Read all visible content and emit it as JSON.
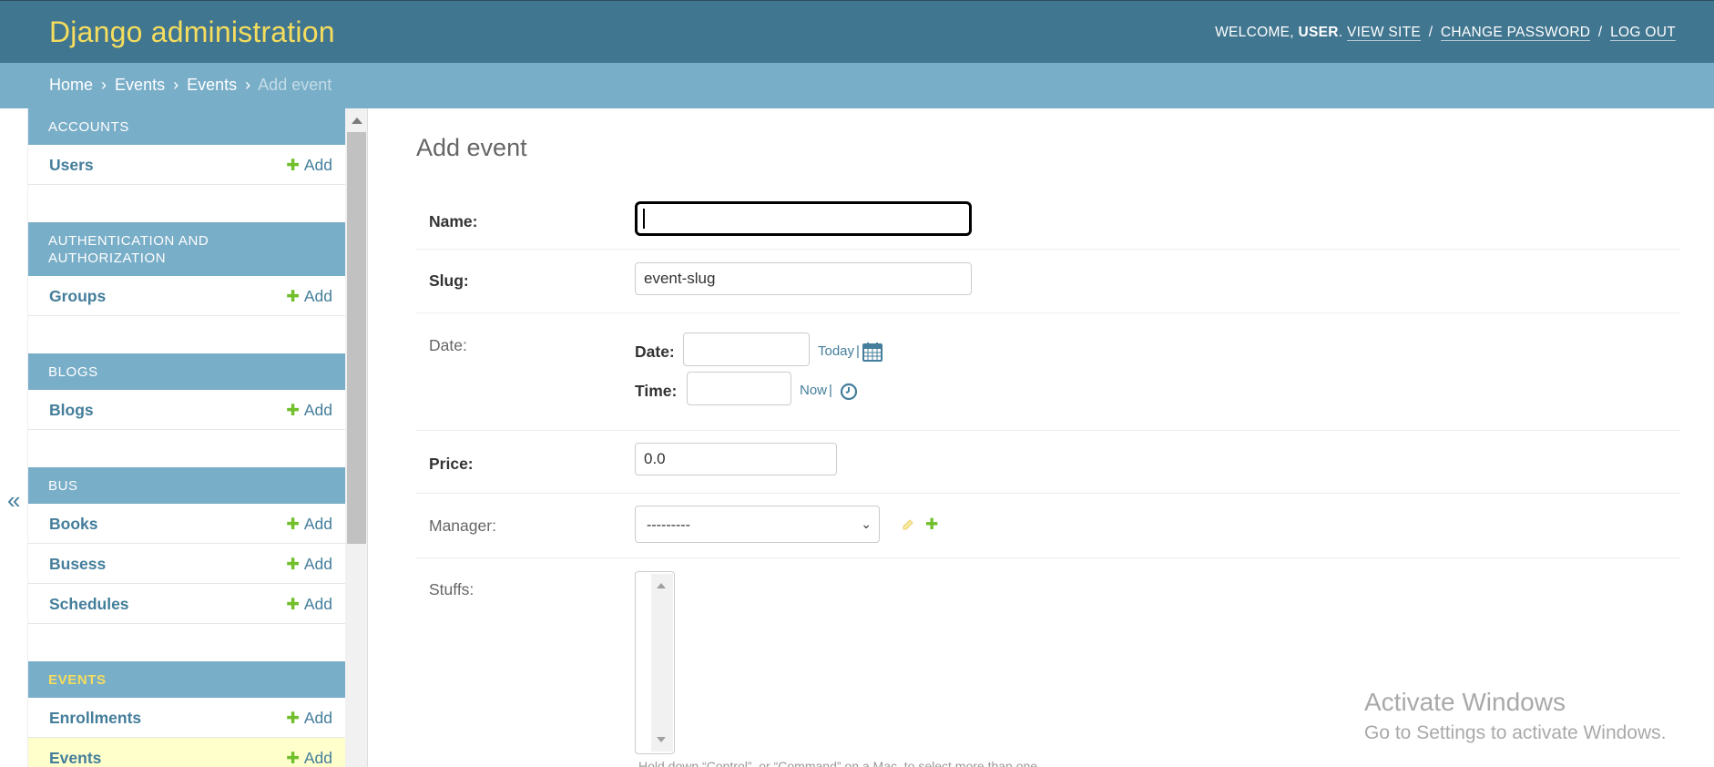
{
  "header": {
    "branding": "Django administration",
    "welcome": "Welcome, ",
    "username": "user",
    "period": ".",
    "view_site": "View site",
    "change_password": "Change password",
    "log_out": "Log out",
    "sep": "/"
  },
  "breadcrumbs": {
    "home": "Home",
    "app": "Events",
    "model": "Events",
    "current": "Add event",
    "sep": "›"
  },
  "toggle": {
    "label": "«"
  },
  "sidebar": {
    "modules": [
      {
        "caption": "Accounts",
        "models": [
          {
            "name": "Users",
            "add": "Add"
          }
        ]
      },
      {
        "caption": "Authentication and Authorization",
        "models": [
          {
            "name": "Groups",
            "add": "Add"
          }
        ]
      },
      {
        "caption": "Blogs",
        "models": [
          {
            "name": "Blogs",
            "add": "Add"
          }
        ]
      },
      {
        "caption": "Bus",
        "models": [
          {
            "name": "Books",
            "add": "Add"
          },
          {
            "name": "Busess",
            "add": "Add"
          },
          {
            "name": "Schedules",
            "add": "Add"
          }
        ]
      },
      {
        "caption": "Events",
        "models": [
          {
            "name": "Enrollments",
            "add": "Add"
          },
          {
            "name": "Events",
            "add": "Add"
          }
        ]
      }
    ],
    "add_icon": "plus-icon"
  },
  "content": {
    "title": "Add event",
    "name_label": "Name:",
    "name_value": "",
    "slug_label": "Slug:",
    "slug_value": "event-slug",
    "date_label": "Date:",
    "date_sub_label": "Date:",
    "time_sub_label": "Time:",
    "today_link": "Today",
    "now_link": "Now",
    "pipe": "|",
    "price_label": "Price:",
    "price_value": "0.0",
    "manager_label": "Manager:",
    "manager_selected": "---------",
    "stuffs_label": "Stuffs:",
    "help_text": "Hold down “Control”, or “Command” on a Mac, to select more than one."
  },
  "watermark": {
    "line1": "Activate Windows",
    "line2": "Go to Settings to activate Windows."
  },
  "colors": {
    "header_bg": "#417690",
    "breadcrumb_bg": "#79aec8",
    "branding": "#f5dd5d",
    "link": "#447e9b",
    "add_green": "#70bf2b",
    "current_row": "#ffffcc"
  }
}
